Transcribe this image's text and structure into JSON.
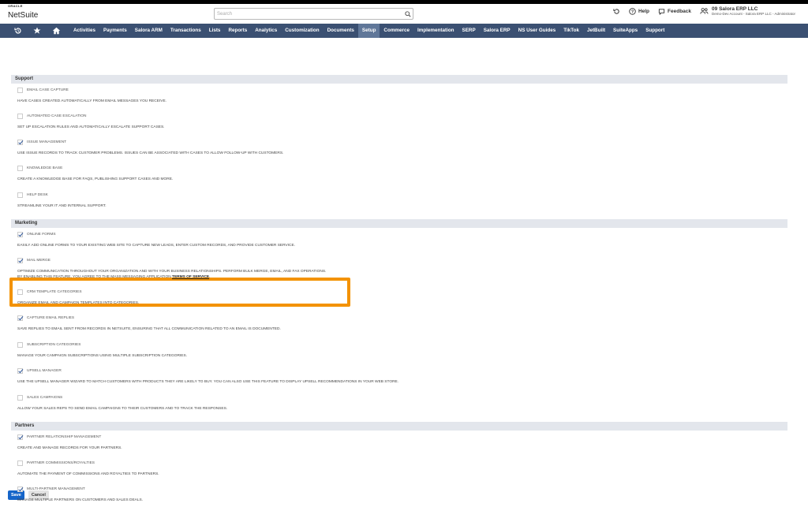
{
  "header": {
    "logo_top": "ORACLE",
    "logo_main": "NetSuite",
    "search_placeholder": "Search",
    "help_label": "Help",
    "feedback_label": "Feedback",
    "account_name": "09 Salora ERP LLC",
    "account_sub": "Demo-Dev Account - Salora ERP LLC - Administrator"
  },
  "nav": {
    "items": [
      {
        "label": "Activities"
      },
      {
        "label": "Payments"
      },
      {
        "label": "Salora ARM"
      },
      {
        "label": "Transactions"
      },
      {
        "label": "Lists"
      },
      {
        "label": "Reports"
      },
      {
        "label": "Analytics"
      },
      {
        "label": "Customization"
      },
      {
        "label": "Documents"
      },
      {
        "label": "Setup",
        "active": true
      },
      {
        "label": "Commerce"
      },
      {
        "label": "Implementation"
      },
      {
        "label": "SERP"
      },
      {
        "label": "Salora ERP"
      },
      {
        "label": "NS User Guides"
      },
      {
        "label": "TikTok"
      },
      {
        "label": "JetBuilt"
      },
      {
        "label": "SuiteApps"
      },
      {
        "label": "Support"
      }
    ]
  },
  "sections": [
    {
      "title": "Support",
      "features": [
        {
          "label": "Email Case Capture",
          "checked": false,
          "desc": "Have cases created automatically from email messages you receive."
        },
        {
          "label": "Automated Case Escalation",
          "checked": false,
          "desc": "Set up escalation rules and automatically escalate support cases."
        },
        {
          "label": "Issue Management",
          "checked": true,
          "desc": "Use issue records to track customer problems. Issues can be associated with cases to allow follow-up with customers."
        },
        {
          "label": "Knowledge Base",
          "checked": false,
          "desc": "Create a knowledge base for FAQs, publishing support cases and more."
        },
        {
          "label": "Help Desk",
          "checked": false,
          "desc": "Streamline your IT and internal support."
        }
      ]
    },
    {
      "title": "Marketing",
      "features": [
        {
          "label": "Online Forms",
          "checked": true,
          "desc": "Easily add online forms to your existing web site to capture new leads, enter custom records, and provide customer service."
        },
        {
          "label": "Mail Merge",
          "checked": true,
          "desc": "Optimize communication throughout your organization and with your business relationships. Perform bulk merge, email, and fax operations.",
          "desc2": "By enabling this feature, you agree to the mass messaging application ",
          "link": "Terms of Service",
          "desc2_end": "."
        },
        {
          "label": "CRM Template Categories",
          "checked": false,
          "desc": "Organize email and campaign templates into categories."
        },
        {
          "label": "Capture Email Replies",
          "checked": true,
          "desc": "Save replies to email sent from records in NetSuite, ensuring that all communication related to an email is documented."
        },
        {
          "label": "Subscription Categories",
          "checked": false,
          "desc": "Manage your campaign subscriptions using multiple subscription categories."
        },
        {
          "label": "Upsell Manager",
          "checked": true,
          "desc": "Use the Upsell Manager Wizard to match customers with products they are likely to buy. You can also use this feature to display upsell recommendations in your web store."
        },
        {
          "label": "Sales Campaigns",
          "checked": false,
          "desc": "Allow your sales reps to send email campaigns to their customers and to track the responses."
        }
      ]
    },
    {
      "title": "Partners",
      "features": [
        {
          "label": "Partner Relationship Management",
          "checked": true,
          "desc": "Create and manage records for your partners."
        },
        {
          "label": "Partner Commissions/Royalties",
          "checked": false,
          "desc": "Automate the payment of commissions and royalties to partners."
        },
        {
          "label": "Multi-Partner Management",
          "checked": true,
          "desc": "Manage multiple partners on customers and sales deals."
        }
      ]
    }
  ],
  "buttons": {
    "save": "Save",
    "cancel": "Cancel"
  },
  "colors": {
    "nav_bg": "#3b5072",
    "nav_active": "#607799",
    "highlight": "#f39200",
    "save_btn": "#1665c9"
  }
}
